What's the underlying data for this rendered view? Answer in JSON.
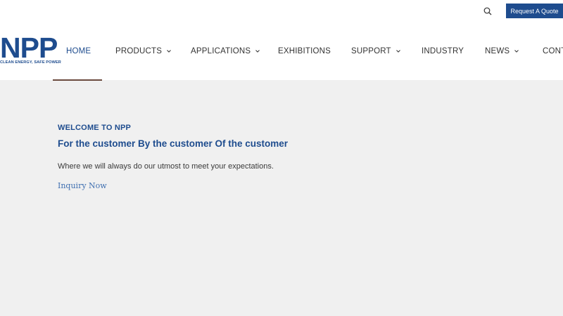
{
  "brand": {
    "logo_text": "NPP",
    "tagline": "CLEAN ENERGY, SAFE POWER",
    "color": "#1e4c8e"
  },
  "header": {
    "search_icon": "search-icon",
    "cta_label": "Request A Quote"
  },
  "nav": {
    "items": [
      {
        "label": "HOME",
        "active": true
      },
      {
        "label": "PRODUCTS",
        "dropdown": true
      },
      {
        "label": "APPLICATIONS",
        "dropdown": true
      },
      {
        "label": "EXHIBITIONS"
      },
      {
        "label": "SUPPORT",
        "dropdown": true
      },
      {
        "label": "INDUSTRY"
      },
      {
        "label": "NEWS",
        "dropdown": true
      },
      {
        "label": "CONT"
      }
    ]
  },
  "hero": {
    "eyebrow": "WELCOME TO NPP",
    "title": "For the customer By the customer Of the customer",
    "text": "Where we will always do our utmost to meet your expectations.",
    "link": "Inquiry Now"
  },
  "colors": {
    "primary": "#1e4c8e",
    "background": "#f0f0f0",
    "link": "#3f6fb0"
  }
}
